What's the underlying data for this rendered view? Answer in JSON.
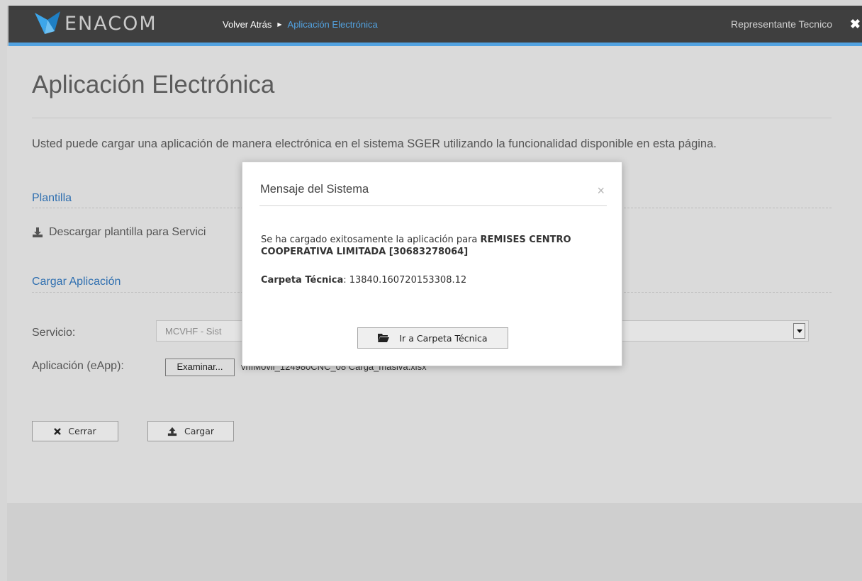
{
  "header": {
    "brand": "ENACOM",
    "breadcrumb_back": "Volver Atrás",
    "breadcrumb_current": "Aplicación Electrónica",
    "user_name": "Representante Tecnico"
  },
  "page": {
    "title": "Aplicación Electrónica",
    "intro": "Usted puede cargar una aplicación de manera electrónica en el sistema SGER utilizando la funcionalidad disponible en esta página."
  },
  "plantilla": {
    "heading": "Plantilla",
    "download_link": "Descargar plantilla para Servici"
  },
  "cargar": {
    "heading": "Cargar Aplicación",
    "servicio_label": "Servicio:",
    "servicio_value": "MCVHF - Sist",
    "aplicacion_label": "Aplicación (eApp):",
    "browse_button": "Examinar...",
    "file_name": "vhfMovil_124980CNC_08 Carga_masiva.xlsx"
  },
  "actions": {
    "close_label": "Cerrar",
    "upload_label": "Cargar"
  },
  "modal": {
    "title": "Mensaje del Sistema",
    "close": "×",
    "msg_prefix": "Se ha cargado exitosamente la aplicación para ",
    "msg_entity": "REMISES CENTRO COOPERATIVA LIMITADA [30683278064]",
    "carpeta_label": "Carpeta Técnica",
    "carpeta_sep": ": ",
    "carpeta_value": "13840.160720153308.12",
    "go_button": "Ir a Carpeta Técnica"
  },
  "colors": {
    "topbar": "#3f3f3f",
    "accent": "#52a2e0",
    "link": "#2f6fb0",
    "brand_mark": "#3da6ea"
  }
}
